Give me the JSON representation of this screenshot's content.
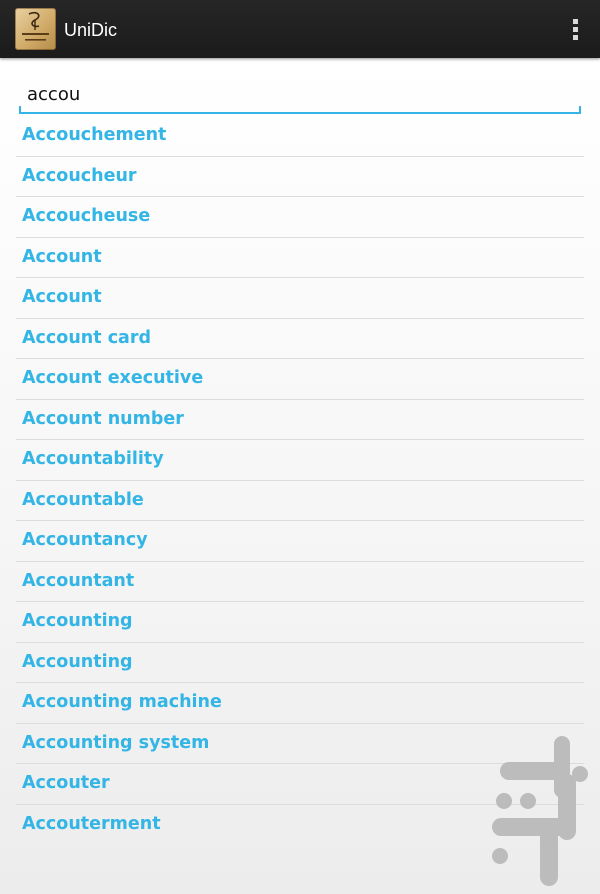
{
  "app": {
    "title": "UniDic",
    "icon": "app-logo-icon",
    "overflow_icon": "more-vert-icon"
  },
  "search": {
    "value": "accou",
    "accent_color": "#33b5e5"
  },
  "results": [
    {
      "label": "Accouchement"
    },
    {
      "label": "Accoucheur"
    },
    {
      "label": "Accoucheuse"
    },
    {
      "label": "Account"
    },
    {
      "label": "Account"
    },
    {
      "label": "Account card"
    },
    {
      "label": "Account executive"
    },
    {
      "label": "Account number"
    },
    {
      "label": "Accountability"
    },
    {
      "label": "Accountable"
    },
    {
      "label": "Accountancy"
    },
    {
      "label": "Accountant"
    },
    {
      "label": "Accounting"
    },
    {
      "label": "Accounting"
    },
    {
      "label": "Accounting machine"
    },
    {
      "label": "Accounting system"
    },
    {
      "label": "Accouter"
    },
    {
      "label": "Accouterment"
    }
  ],
  "colors": {
    "action_bar": "#1f1f1f",
    "link": "#33b5e5",
    "divider": "#dcdcdc"
  }
}
